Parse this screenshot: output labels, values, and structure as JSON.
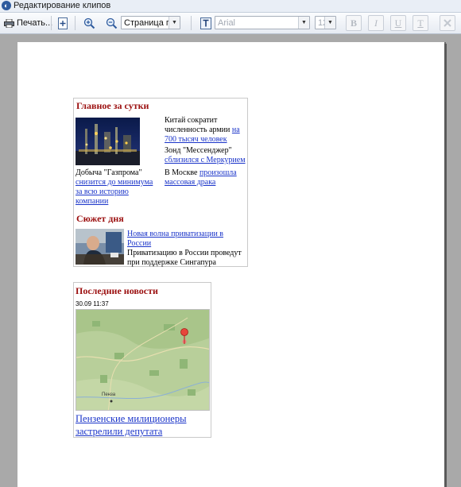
{
  "window": {
    "title": "Редактирование клипов"
  },
  "toolbar": {
    "print_label": "Печать...",
    "page_mode_value": "Страница полно",
    "font_value": "Arial",
    "font_size_value": "12",
    "bold_label": "B",
    "italic_label": "I",
    "underline_label": "U",
    "text_color_label": "T"
  },
  "clip_main": {
    "heading": "Главное за сутки",
    "left_plain": "Добыча \"Газпрома\" ",
    "left_link": "снизится до минимума за всю историю компании",
    "news1_plain": "Китай сократит численность армии ",
    "news1_link": "на 700 тысяч человек",
    "news2_plain": "Зонд \"Мессенджер\" ",
    "news2_link": "сблизился с Меркурием",
    "news3_plain": "В Москве ",
    "news3_link": "произошла массовая драка",
    "story_heading": "Сюжет дня",
    "story_link": "Новая волна приватизации в России",
    "story_text": "Приватизацию в России проведут при поддержке Сингапура"
  },
  "clip_latest": {
    "heading": "Последние новости",
    "timestamp": "30.09 11:37",
    "headline": "Пензенские милиционеры застрелили депутата",
    "map_label_city": "Пенза"
  }
}
